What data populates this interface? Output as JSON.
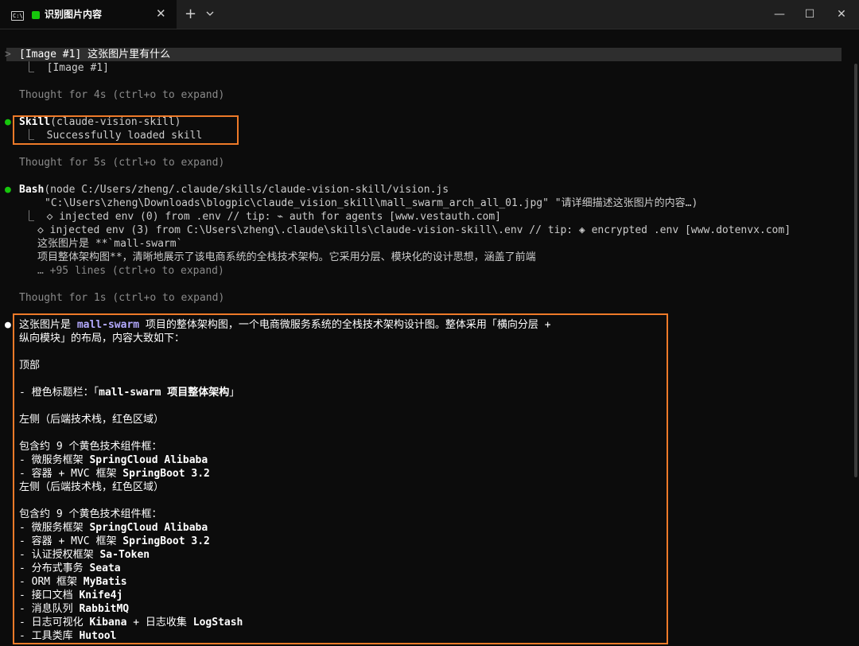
{
  "tab": {
    "icon_glyph": "C:\\",
    "title": "识别图片内容",
    "close": "✕",
    "new_tab": "+"
  },
  "window": {
    "minimize": "—",
    "maximize": "☐",
    "close": "✕"
  },
  "terminal": {
    "prompt_chevron": ">",
    "user_input": "[Image #1] 这张图片里有什么",
    "image_ref": "⎿  [Image #1]",
    "thought1": "Thought for 4s (ctrl+o to expand)",
    "skill_dot": "●",
    "skill_name": "Skill",
    "skill_args": "(claude-vision-skill)",
    "skill_result": "⎿  Successfully loaded skill",
    "thought2": "Thought for 5s (ctrl+o to expand)",
    "bash_dot": "●",
    "bash_name": "Bash",
    "bash_cmd1": "(node C:/Users/zheng/.claude/skills/claude-vision-skill/vision.js",
    "bash_cmd2": "\"C:\\Users\\zheng\\Downloads\\blogpic\\claude_vision_skill\\mall_swarm_arch_all_01.jpg\" \"请详细描述这张图片的内容…)",
    "bash_out1": "⎿  ◇ injected env (0) from .env // tip: ⌁ auth for agents [www.vestauth.com]",
    "bash_out2": "◇ injected env (3) from C:\\Users\\zheng\\.claude\\skills\\claude-vision-skill\\.env // tip: ◈ encrypted .env [www.dotenvx.com]",
    "bash_out3": "这张图片是 **`mall-swarm`",
    "bash_out4": "项目整体架构图**，清晰地展示了该电商系统的全栈技术架构。它采用分层、模块化的设计思想，涵盖了前端",
    "bash_more": "… +95 lines (ctrl+o to expand)",
    "thought3": "Thought for 1s (ctrl+o to expand)",
    "answer_dot": "●",
    "answer_pre": "这张图片是 ",
    "answer_project": "mall-swarm",
    "answer_post": " 项目的整体架构图，一个电商微服务系统的全栈技术架构设计图。整体采用「横向分层 +",
    "answer_line2": "纵向模块」的布局，内容大致如下：",
    "top_heading": "顶部",
    "title_bar_prefix": "- 橙色标题栏：「",
    "title_bar_value": "mall-swarm 项目整体架构",
    "title_bar_suffix": "」",
    "left_heading_1": "左侧（后端技术栈，红色区域）",
    "contains_1": "包含约 9 个黄色技术组件框：",
    "list_a": [
      {
        "label": "- 微服务框架 ",
        "value": "SpringCloud Alibaba"
      },
      {
        "label": "- 容器 + MVC 框架 ",
        "value": "SpringBoot 3.2"
      }
    ],
    "left_heading_2": "左侧（后端技术栈，红色区域）",
    "contains_2": "包含约 9 个黄色技术组件框：",
    "list_b": [
      {
        "label": "- 微服务框架 ",
        "value": "SpringCloud Alibaba"
      },
      {
        "label": "- 容器 + MVC 框架 ",
        "value": "SpringBoot 3.2"
      },
      {
        "label": "- 认证授权框架 ",
        "value": "Sa-Token"
      },
      {
        "label": "- 分布式事务 ",
        "value": "Seata"
      },
      {
        "label": "- ORM 框架 ",
        "value": "MyBatis"
      },
      {
        "label": "- 接口文档 ",
        "value": "Knife4j"
      },
      {
        "label": "- 消息队列 ",
        "value": "RabbitMQ"
      },
      {
        "label": "- 日志可视化 ",
        "value": "Kibana",
        "label2": " + 日志收集 ",
        "value2": "LogStash"
      },
      {
        "label": "- 工具类库 ",
        "value": "Hutool"
      }
    ]
  },
  "colors": {
    "background": "#0c0c0c",
    "highlight_box": "#ee7a29",
    "accent": "#b4aaff",
    "success": "#16c60c"
  }
}
